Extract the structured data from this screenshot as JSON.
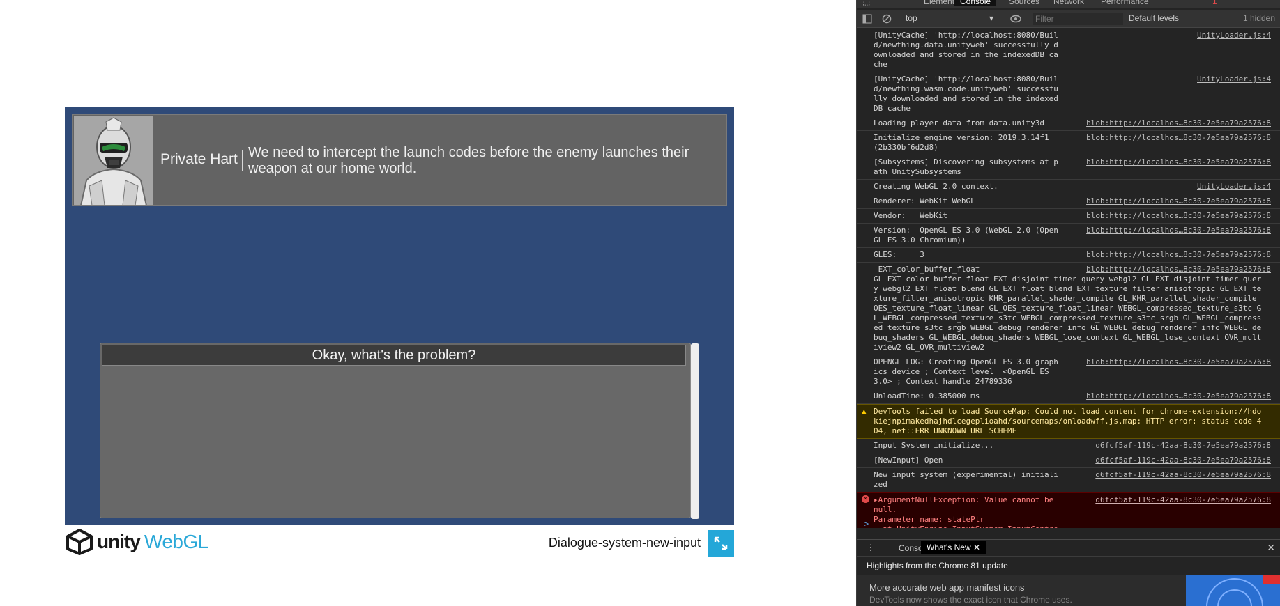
{
  "game": {
    "speaker": "Private Hart",
    "dialogue": "We need to intercept the launch codes before the enemy launches their weapon at our home world.",
    "choices": [
      "Okay, what's the problem?"
    ]
  },
  "footer": {
    "logo_unity": "unity",
    "logo_webgl": "WebGL",
    "build_title": "Dialogue-system-new-input"
  },
  "devtools": {
    "tabs": [
      "Elements",
      "Console",
      "Sources",
      "Network",
      "Performance"
    ],
    "active_tab": "Console",
    "error_badge": "1",
    "toolbar": {
      "context": "top",
      "filter_placeholder": "Filter",
      "levels": "Default levels",
      "hidden": "1 hidden"
    },
    "messages": [
      {
        "level": "info",
        "text": "[UnityCache] 'http://localhost:8080/Build/newthing.data.unityweb' successfully downloaded and stored in the indexedDB cache",
        "source": "UnityLoader.js:4"
      },
      {
        "level": "info",
        "text": "[UnityCache] 'http://localhost:8080/Build/newthing.wasm.code.unityweb' successfully downloaded and stored in the indexedDB cache",
        "source": "UnityLoader.js:4"
      },
      {
        "level": "info",
        "text": "Loading player data from data.unity3d",
        "source": "blob:http://localhos…8c30-7e5ea79a2576:8"
      },
      {
        "level": "info",
        "text": "Initialize engine version: 2019.3.14f1 (2b330bf6d2d8)",
        "source": "blob:http://localhos…8c30-7e5ea79a2576:8"
      },
      {
        "level": "info",
        "text": "[Subsystems] Discovering subsystems at path UnitySubsystems",
        "source": "blob:http://localhos…8c30-7e5ea79a2576:8"
      },
      {
        "level": "info",
        "text": "Creating WebGL 2.0 context.",
        "source": "UnityLoader.js:4"
      },
      {
        "level": "info",
        "text": "Renderer: WebKit WebGL",
        "source": "blob:http://localhos…8c30-7e5ea79a2576:8"
      },
      {
        "level": "info",
        "text": "Vendor:   WebKit",
        "source": "blob:http://localhos…8c30-7e5ea79a2576:8"
      },
      {
        "level": "info",
        "text": "Version:  OpenGL ES 3.0 (WebGL 2.0 (OpenGL ES 3.0 Chromium))",
        "source": "blob:http://localhos…8c30-7e5ea79a2576:8"
      },
      {
        "level": "info",
        "text": "GLES:     3",
        "source": "blob:http://localhos…8c30-7e5ea79a2576:8"
      },
      {
        "level": "info",
        "text": " EXT_color_buffer_float\nGL_EXT_color_buffer_float EXT_disjoint_timer_query_webgl2 GL_EXT_disjoint_timer_query_webgl2 EXT_float_blend GL_EXT_float_blend EXT_texture_filter_anisotropic GL_EXT_texture_filter_anisotropic KHR_parallel_shader_compile GL_KHR_parallel_shader_compile OES_texture_float_linear GL_OES_texture_float_linear WEBGL_compressed_texture_s3tc GL_WEBGL_compressed_texture_s3tc WEBGL_compressed_texture_s3tc_srgb GL_WEBGL_compressed_texture_s3tc_srgb WEBGL_debug_renderer_info GL_WEBGL_debug_renderer_info WEBGL_debug_shaders GL_WEBGL_debug_shaders WEBGL_lose_context GL_WEBGL_lose_context OVR_multiview2 GL_OVR_multiview2",
        "source": "blob:http://localhos…8c30-7e5ea79a2576:8"
      },
      {
        "level": "info",
        "text": "OPENGL LOG: Creating OpenGL ES 3.0 graphics device ; Context level  <OpenGL ES 3.0> ; Context handle 24789336",
        "source": "blob:http://localhos…8c30-7e5ea79a2576:8"
      },
      {
        "level": "info",
        "text": "UnloadTime: 0.385000 ms",
        "source": "blob:http://localhos…8c30-7e5ea79a2576:8"
      },
      {
        "level": "warning",
        "text": "DevTools failed to load SourceMap: Could not load content for chrome-extension://hdokiejnpimakedhajhdlcegeplioahd/sourcemaps/onloadwff.js.map: HTTP error: status code 404, net::ERR_UNKNOWN_URL_SCHEME",
        "source": ""
      },
      {
        "level": "info",
        "text": "Input System initialize...",
        "source": "d6fcf5af-119c-42aa-8c30-7e5ea79a2576:8"
      },
      {
        "level": "info",
        "text": "[NewInput] Open",
        "source": "d6fcf5af-119c-42aa-8c30-7e5ea79a2576:8"
      },
      {
        "level": "info",
        "text": "New input system (experimental) initialized",
        "source": "d6fcf5af-119c-42aa-8c30-7e5ea79a2576:8"
      },
      {
        "level": "error",
        "text": "▸ArgumentNullException: Value cannot be null.\nParameter name: statePtr\n  at UnityEngine.InputSystem.InputControl`1[TValue].ReadValueFromState (System.Void* statePtr) [0x00000] in <00000000000000000000000000000000>:0\n\n(Filename: currently not available on il2cpp Line: -1)",
        "source": "d6fcf5af-119c-42aa-8c30-7e5ea79a2576:8"
      }
    ],
    "prompt": ">",
    "drawer": {
      "more": "⋮",
      "tabs": [
        "Console",
        "What's New"
      ],
      "active_tab": "What's New",
      "heading": "Highlights from the Chrome 81 update",
      "feature_title": "More accurate web app manifest icons",
      "feature_desc": "DevTools now shows the exact icon that Chrome uses."
    }
  }
}
